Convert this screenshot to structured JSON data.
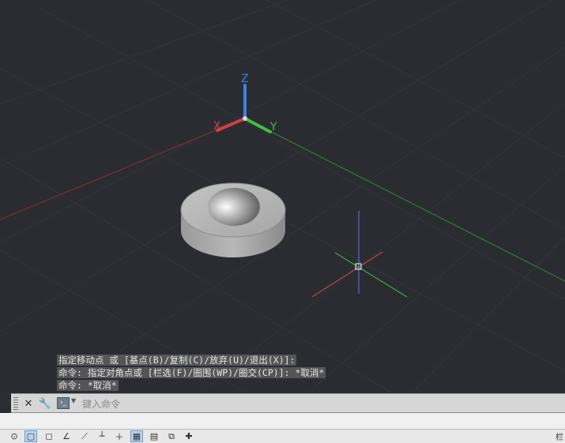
{
  "viewport": {
    "background": "#2a2c32",
    "ucs": {
      "x_label": "X",
      "y_label": "Y",
      "z_label": "Z",
      "x_color": "#d04040",
      "y_color": "#40c040",
      "z_color": "#4080e0"
    },
    "cursor_axes": {
      "x_color": "#e05050",
      "y_color": "#40d040",
      "z_color": "#7070ff"
    },
    "object": "gray cylinder with hemispherical dome inset"
  },
  "command_history": [
    "指定移动点 或 [基点(B)/复制(C)/放弃(U)/退出(X)]:",
    "命令: 指定对角点或 [栏选(F)/圈围(WP)/圈交(CP)]: *取消*",
    "命令: *取消*"
  ],
  "command_line": {
    "placeholder": "键入命令",
    "close_icon": "close-icon",
    "settings_icon": "wrench-icon",
    "command_icon": "command-prompt-icon"
  },
  "status_bar": {
    "icons": [
      "dynamic-ucs-icon",
      "grid-icon",
      "snap-icon",
      "ortho-icon",
      "polar-icon",
      "osnap-icon",
      "lineweight-icon",
      "transparency-icon",
      "quick-properties-icon",
      "selection-cycling-icon",
      "annotation-monitor-icon"
    ],
    "right_glyph": "栏"
  }
}
